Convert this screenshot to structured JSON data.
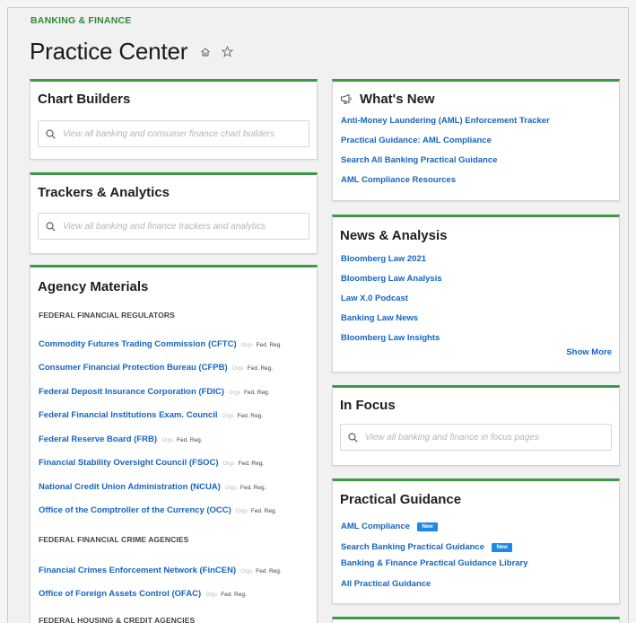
{
  "header": {
    "eyebrow": "BANKING & FINANCE",
    "title": "Practice Center",
    "home_icon": "home-icon",
    "star_icon": "star-icon"
  },
  "chart_builders": {
    "title": "Chart Builders",
    "search_placeholder": "View all banking and consumer finance chart builders"
  },
  "trackers": {
    "title": "Trackers & Analytics",
    "search_placeholder": "View all banking and finance trackers and analytics"
  },
  "agency": {
    "title": "Agency Materials",
    "orgs_label": "Orgs",
    "fed_reg_label": "Fed. Reg.",
    "sections": [
      {
        "label": "FEDERAL FINANCIAL REGULATORS",
        "items": [
          "Commodity Futures Trading Commission (CFTC)",
          "Consumer Financial Protection Bureau (CFPB)",
          "Federal Deposit Insurance Corporation (FDIC)",
          "Federal Financial Institutions Exam. Council",
          "Federal Reserve Board (FRB)",
          "Financial Stability Oversight Council (FSOC)",
          "National Credit Union Administration (NCUA)",
          "Office of the Comptroller of the Currency (OCC)"
        ]
      },
      {
        "label": "FEDERAL FINANCIAL CRIME AGENCIES",
        "items": [
          "Financial Crimes Enforcement Network (FinCEN)",
          "Office of Foreign Assets Control (OFAC)"
        ]
      },
      {
        "label": "FEDERAL HOUSING & CREDIT AGENCIES",
        "items": []
      }
    ]
  },
  "whats_new": {
    "title": "What's New",
    "icon": "megaphone-icon",
    "links": [
      "Anti-Money Laundering (AML) Enforcement Tracker",
      "Practical Guidance: AML Compliance",
      "Search All Banking Practical Guidance",
      "AML Compliance Resources"
    ]
  },
  "news": {
    "title": "News & Analysis",
    "links": [
      "Bloomberg Law 2021",
      "Bloomberg Law Analysis",
      "Law X.0 Podcast",
      "Banking Law News",
      "Bloomberg Law Insights"
    ],
    "show_more": "Show More"
  },
  "in_focus": {
    "title": "In Focus",
    "search_placeholder": "View all banking and finance in focus pages"
  },
  "practical": {
    "title": "Practical Guidance",
    "badge": "New",
    "links": [
      "AML Compliance",
      "Search Banking Practical Guidance",
      "Banking & Finance Practical Guidance Library",
      "All Practical Guidance"
    ]
  },
  "colors": {
    "accent_green": "#3a9a48",
    "link_blue": "#1565c0",
    "badge_blue": "#1e88e5"
  }
}
